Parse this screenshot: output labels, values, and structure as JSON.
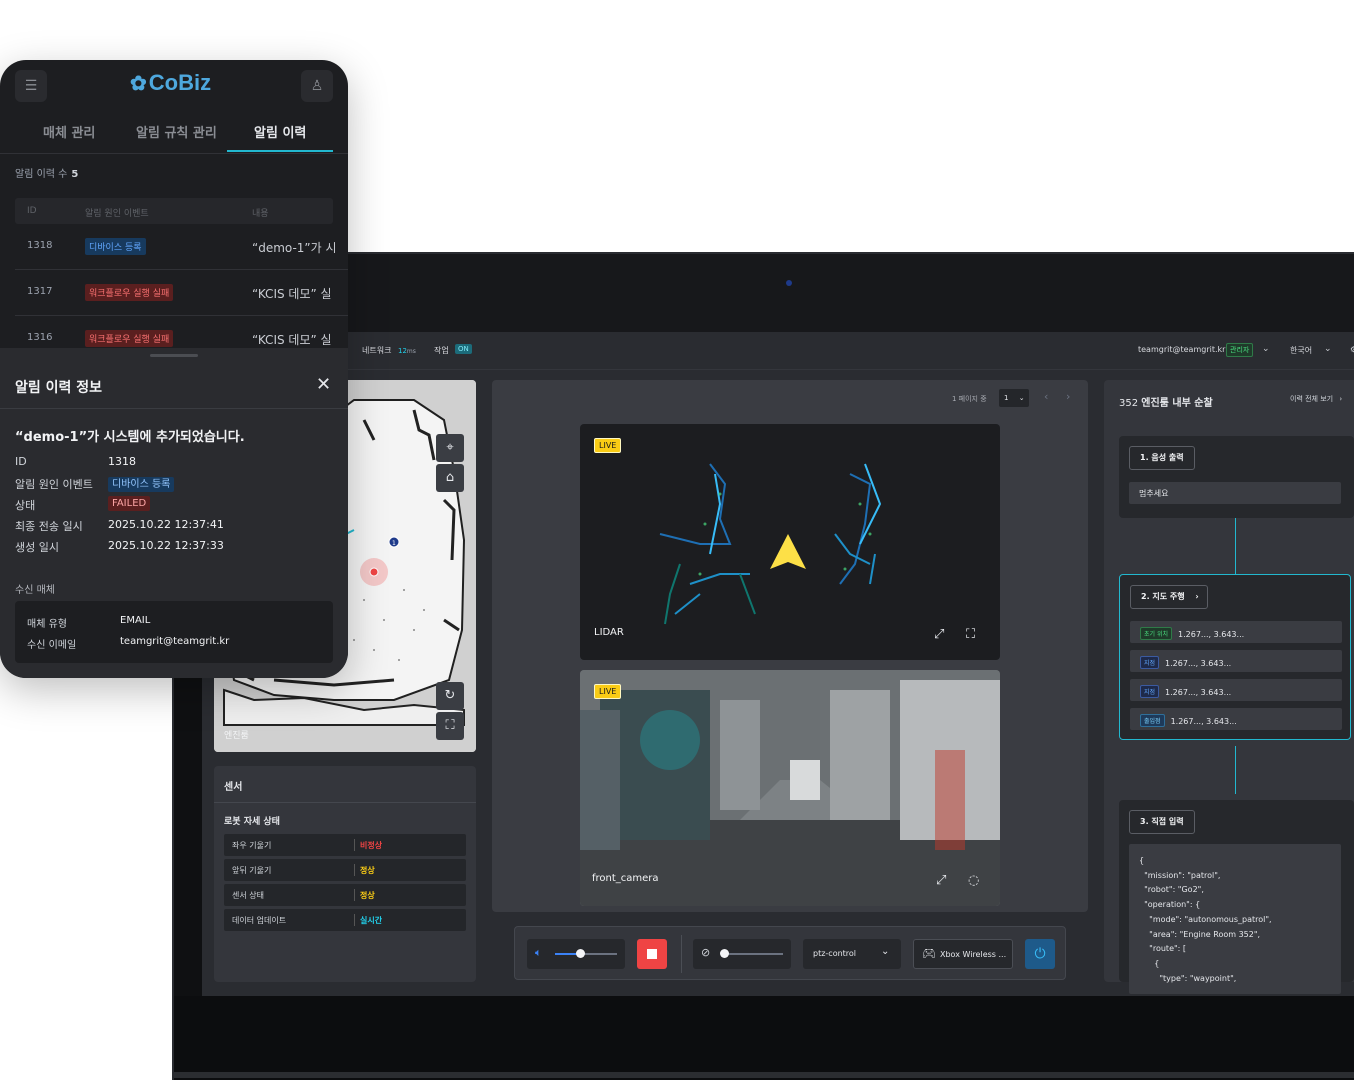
{
  "colors": {
    "accent": "#22b8cf",
    "danger": "#ef4444",
    "success": "#facc15",
    "brand": "#4ea8de"
  },
  "mobile": {
    "logo": "CoBiz",
    "logo_icon": "cobiz-logo-icon",
    "menu_icon": "hamburger-menu-icon",
    "user_icon": "user-icon",
    "tabs": [
      {
        "label": "매체 관리"
      },
      {
        "label": "알림 규칙 관리"
      },
      {
        "label": "알림 이력"
      }
    ],
    "count_label": "알림 이력 수",
    "count_value": "5",
    "table": {
      "headers": [
        "ID",
        "알림 원인 이벤트",
        "내용"
      ],
      "rows": [
        {
          "id": "1318",
          "event": "디바이스 등록",
          "event_type": "info",
          "content": "“demo-1”가 시"
        },
        {
          "id": "1317",
          "event": "워크플로우 실행 실패",
          "event_type": "error",
          "content": "“KCIS 데모” 실"
        },
        {
          "id": "1316",
          "event": "워크플로우 실행 실패",
          "event_type": "error",
          "content": "“KCIS 데모” 실"
        }
      ]
    },
    "sheet": {
      "title": "알림 이력 정보",
      "heading": "“demo-1”가 시스템에 추가되었습니다.",
      "fields": [
        {
          "key": "ID",
          "value": "1318"
        },
        {
          "key": "알림 원인 이벤트",
          "value": "디바이스 등록"
        },
        {
          "key": "상태",
          "value": "FAILED"
        },
        {
          "key": "최종 전송 일시",
          "value": "2025.10.22 12:37:41"
        },
        {
          "key": "생성 일시",
          "value": "2025.10.22 12:37:33"
        }
      ],
      "receiver_section": "수신 매체",
      "receiver": [
        {
          "key": "매체 유형",
          "value": "EMAIL"
        },
        {
          "key": "수신 이메일",
          "value": "teamgrit@teamgrit.kr"
        }
      ]
    }
  },
  "desktop": {
    "topbar": {
      "network_label": "네트워크",
      "network_value": "12",
      "network_unit": "ms",
      "job_label": "작업",
      "job_status": "ON",
      "user_email": "teamgrit@teamgrit.kr",
      "user_role": "관리자",
      "language": "한국어"
    },
    "map": {
      "label": "엔진룸",
      "marker_number": "1",
      "tools": [
        "route-tool-icon",
        "location-pin-icon",
        "refresh-icon",
        "fullscreen-icon"
      ]
    },
    "sensor": {
      "title": "센서",
      "subtitle": "로봇 자세 상태",
      "rows": [
        {
          "key": "좌우 기울기",
          "value": "비정상",
          "status": "error"
        },
        {
          "key": "앞뒤 기울기",
          "value": "정상",
          "status": "ok"
        },
        {
          "key": "센서 상태",
          "value": "정상",
          "status": "ok"
        },
        {
          "key": "데이터 업데이트",
          "value": "실시간",
          "status": "live"
        }
      ]
    },
    "video": {
      "pager_text": "1 페이지 중",
      "pager_value": "1",
      "streams": [
        {
          "badge": "LIVE",
          "label": "LIDAR"
        },
        {
          "badge": "LIVE",
          "label": "front_camera"
        }
      ]
    },
    "controls": {
      "volume_level": 0.4,
      "mic_level": 0.05,
      "mode": "ptz-control",
      "gamepad": "Xbox Wireless ..."
    },
    "mission": {
      "number": "352",
      "title": "엔진룸 내부 순찰",
      "history_link": "이력 전체 보기",
      "steps": [
        {
          "label": "1. 음성 출력",
          "input": "멈추세요"
        },
        {
          "label": "2. 지도 주행",
          "waypoints": [
            {
              "tag": "초기 위치",
              "tag_type": "start",
              "coords": "1.267..., 3.643..."
            },
            {
              "tag": "지점",
              "tag_type": "point",
              "coords": "1.267..., 3.643..."
            },
            {
              "tag": "지점",
              "tag_type": "point",
              "coords": "1.267..., 3.643..."
            },
            {
              "tag": "출입점",
              "tag_type": "entry",
              "coords": "1.267..., 3.643..."
            }
          ]
        },
        {
          "label": "3. 직접 입력",
          "json_lines": [
            "{",
            "  \"mission\": \"patrol\",",
            "  \"robot\": \"Go2\",",
            "  \"operation\": {",
            "    \"mode\": \"autonomous_patrol\",",
            "    \"area\": \"Engine Room 352\",",
            "    \"route\": [",
            "      {",
            "        \"type\": \"waypoint\","
          ]
        }
      ]
    }
  }
}
